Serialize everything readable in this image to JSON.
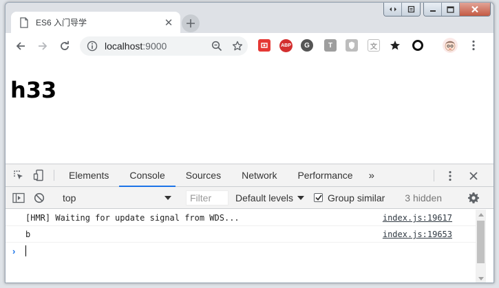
{
  "tab": {
    "title": "ES6 入门导学",
    "close": "✕"
  },
  "toolbar": {
    "url_host": "localhost",
    "url_port": ":9000",
    "extensions": [
      {
        "name": "ext-red",
        "label": "",
        "color": "#e53935"
      },
      {
        "name": "adblock-plus",
        "label": "ABP",
        "color": "#d32f2f"
      },
      {
        "name": "ext-g",
        "label": "G",
        "color": "#555555"
      },
      {
        "name": "ext-t",
        "label": "T",
        "color": "#9e9e9e"
      },
      {
        "name": "ext-shield",
        "label": "",
        "color": "#bdbdbd"
      },
      {
        "name": "ext-translate",
        "label": "文",
        "color": "#bdbdbd"
      }
    ]
  },
  "page": {
    "heading": "h33"
  },
  "devtools": {
    "tabs": [
      "Elements",
      "Console",
      "Sources",
      "Network",
      "Performance"
    ],
    "active_tab": "Console",
    "more": "»",
    "context": "top",
    "filter_placeholder": "Filter",
    "levels": "Default levels",
    "group_similar": "Group similar",
    "hidden": "3 hidden",
    "logs": [
      {
        "message": "[HMR] Waiting for update signal from WDS...",
        "source": "index.js:19617"
      },
      {
        "message": "b",
        "source": "index.js:19653"
      }
    ]
  },
  "colors": {
    "accent": "#1a73e8",
    "frame": "#dee1e6"
  }
}
